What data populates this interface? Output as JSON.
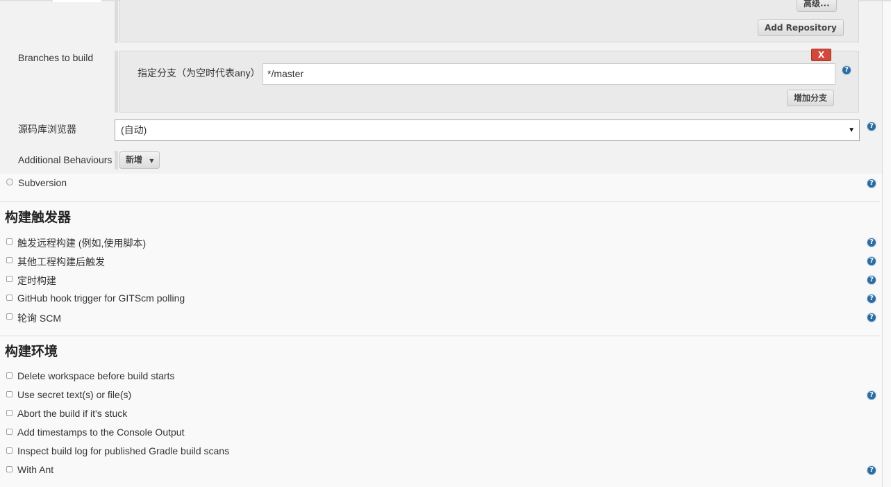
{
  "git": {
    "advanced_button": "高级...",
    "add_repository_button": "Add Repository",
    "branches_label": "Branches to build",
    "branch_delete_button": "X",
    "branch_specifier_label": "指定分支（为空时代表any）",
    "branch_specifier_value": "*/master",
    "add_branch_button": "增加分支",
    "browser_label": "源码库浏览器",
    "browser_selected": "(自动)",
    "additional_behaviours_label": "Additional Behaviours",
    "add_behaviour_button": "新增"
  },
  "scm": {
    "subversion_label": "Subversion"
  },
  "build_triggers": {
    "title": "构建触发器",
    "items": [
      "触发远程构建 (例如,使用脚本)",
      "其他工程构建后触发",
      "定时构建",
      "GitHub hook trigger for GITScm polling",
      "轮询 SCM"
    ]
  },
  "build_environment": {
    "title": "构建环境",
    "items": [
      "Delete workspace before build starts",
      "Use secret text(s) or file(s)",
      "Abort the build if it's stuck",
      "Add timestamps to the Console Output",
      "Inspect build log for published Gradle build scans",
      "With Ant"
    ]
  },
  "icons": {
    "help": "?",
    "dropdown_caret": "▼"
  },
  "colors": {
    "help_icon": "#2d6ca2",
    "delete_button": "#d24939"
  }
}
